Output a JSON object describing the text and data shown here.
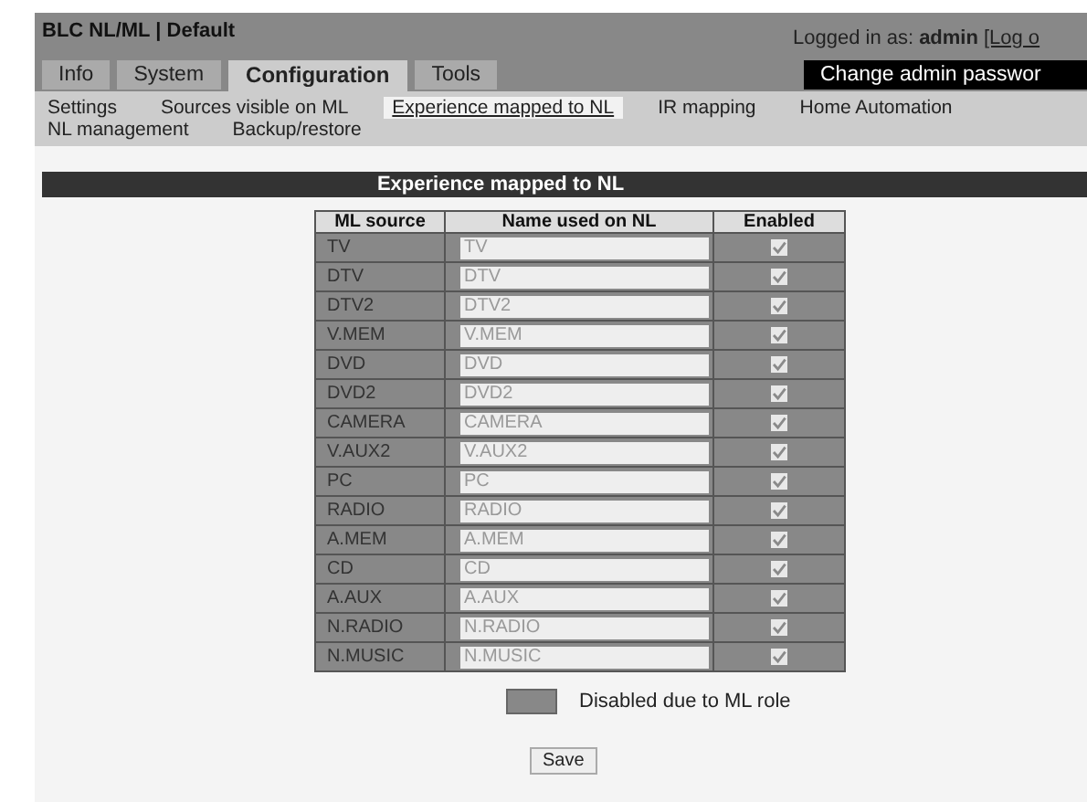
{
  "header": {
    "title": "BLC NL/ML | Default",
    "login_label": "Logged in as:",
    "user": "admin",
    "logout_link": "[Log o"
  },
  "tabs": [
    {
      "label": "Info",
      "selected": false
    },
    {
      "label": "System",
      "selected": false
    },
    {
      "label": "Configuration",
      "selected": true
    },
    {
      "label": "Tools",
      "selected": false
    }
  ],
  "admin_button": "Change admin passwor",
  "subnav": [
    {
      "label": "Settings",
      "selected": false
    },
    {
      "label": "Sources visible on ML",
      "selected": false
    },
    {
      "label": "Experience mapped to NL",
      "selected": true
    },
    {
      "label": "IR mapping",
      "selected": false
    },
    {
      "label": "Home Automation",
      "selected": false
    },
    {
      "label": "NL management",
      "selected": false
    },
    {
      "label": "Backup/restore",
      "selected": false
    }
  ],
  "panel_title": "Experience mapped to NL",
  "table": {
    "columns": [
      "ML source",
      "Name used on NL",
      "Enabled"
    ],
    "rows": [
      {
        "source": "TV",
        "name": "TV",
        "enabled": true,
        "disabled": true
      },
      {
        "source": "DTV",
        "name": "DTV",
        "enabled": true,
        "disabled": true
      },
      {
        "source": "DTV2",
        "name": "DTV2",
        "enabled": true,
        "disabled": true
      },
      {
        "source": "V.MEM",
        "name": "V.MEM",
        "enabled": true,
        "disabled": true
      },
      {
        "source": "DVD",
        "name": "DVD",
        "enabled": true,
        "disabled": true
      },
      {
        "source": "DVD2",
        "name": "DVD2",
        "enabled": true,
        "disabled": true
      },
      {
        "source": "CAMERA",
        "name": "CAMERA",
        "enabled": true,
        "disabled": true
      },
      {
        "source": "V.AUX2",
        "name": "V.AUX2",
        "enabled": true,
        "disabled": true
      },
      {
        "source": "PC",
        "name": "PC",
        "enabled": true,
        "disabled": true
      },
      {
        "source": "RADIO",
        "name": "RADIO",
        "enabled": true,
        "disabled": true
      },
      {
        "source": "A.MEM",
        "name": "A.MEM",
        "enabled": true,
        "disabled": true
      },
      {
        "source": "CD",
        "name": "CD",
        "enabled": true,
        "disabled": true
      },
      {
        "source": "A.AUX",
        "name": "A.AUX",
        "enabled": true,
        "disabled": true
      },
      {
        "source": "N.RADIO",
        "name": "N.RADIO",
        "enabled": true,
        "disabled": true
      },
      {
        "source": "N.MUSIC",
        "name": "N.MUSIC",
        "enabled": true,
        "disabled": true
      }
    ]
  },
  "legend": "Disabled due to ML role",
  "save_button": "Save"
}
